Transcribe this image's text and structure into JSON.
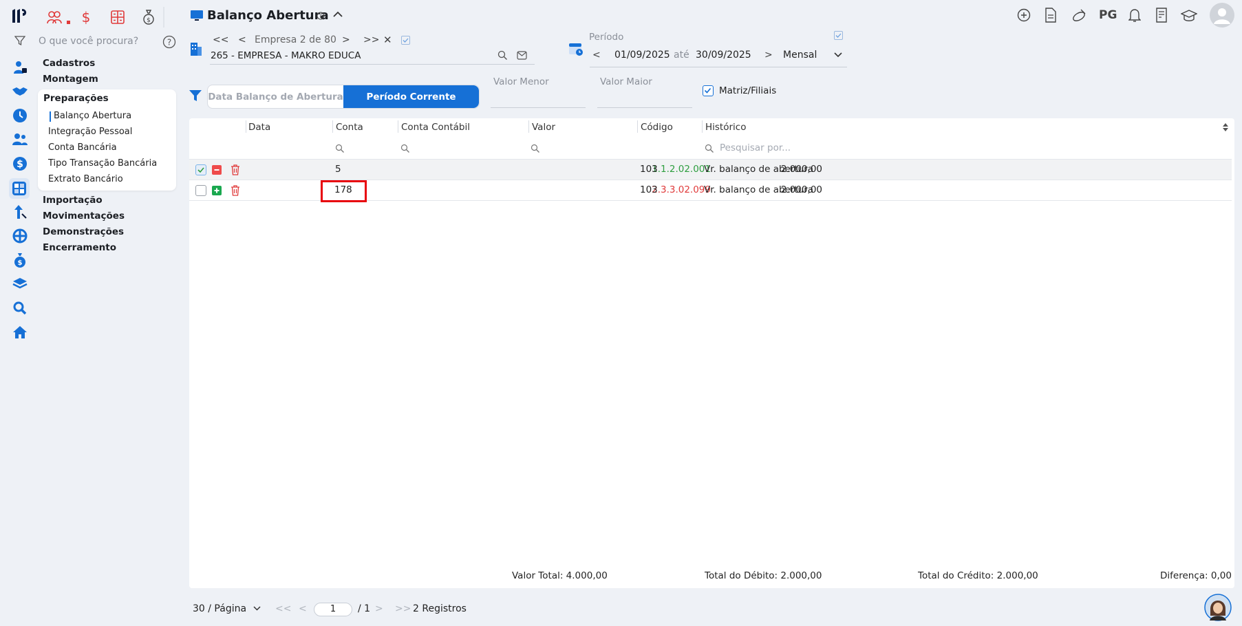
{
  "app": {
    "title": "Balanço Abertura",
    "search_placeholder": "O que você procura?",
    "user_initials": "PG"
  },
  "menu": {
    "sections": [
      "Cadastros",
      "Montagem",
      "Preparações",
      "Importação",
      "Movimentações",
      "Demonstrações",
      "Encerramento"
    ],
    "preparacoes_items": [
      "Balanço Abertura",
      "Integração Pessoal",
      "Conta Bancária",
      "Tipo Transação Bancária",
      "Extrato Bancário"
    ],
    "active_item": "Balanço Abertura"
  },
  "empresa": {
    "nav_label": "Empresa 2 de 80",
    "selected": "265 - EMPRESA - MAKRO EDUCA"
  },
  "periodo": {
    "label": "Período",
    "start": "01/09/2025",
    "separator": "até",
    "end": "30/09/2025",
    "frequency": "Mensal"
  },
  "filters": {
    "tabs": [
      "Data Balanço de Abertura",
      "Período Corrente"
    ],
    "active_tab": "Período Corrente",
    "valor_menor_label": "Valor Menor",
    "valor_maior_label": "Valor Maior",
    "matriz_label": "Matriz/Filiais",
    "matriz_checked": true
  },
  "table": {
    "columns": [
      "Data",
      "Conta",
      "Conta Contábil",
      "Valor",
      "Código",
      "Histórico"
    ],
    "historico_placeholder": "Pesquisar por...",
    "rows": [
      {
        "data": "",
        "conta": "5",
        "conta_contabil": "1.1.2.02.001",
        "valor": "2.000,00",
        "codigo": "103",
        "historico": "Vr. balanço de abertura",
        "type": "debito",
        "checked": true
      },
      {
        "data": "",
        "conta": "178",
        "conta_contabil": "2.3.3.02.099",
        "valor": "2.000,00",
        "codigo": "103",
        "historico": "Vr. balanço de abertura",
        "type": "credito",
        "checked": false
      }
    ]
  },
  "totals": {
    "valor_total": "Valor Total: 4.000,00",
    "total_debito": "Total do Débito: 2.000,00",
    "total_credito": "Total do Crédito: 2.000,00",
    "diferenca": "Diferença: 0,00"
  },
  "pagination": {
    "per_page": "30 / Página",
    "current_page": "1",
    "total_pages": "/ 1",
    "records": "2 Registros"
  },
  "colors": {
    "accent": "#1670d6",
    "debit_green": "#2e9e3f",
    "credit_red": "#e03a3a",
    "highlight_red": "#e8000b"
  }
}
